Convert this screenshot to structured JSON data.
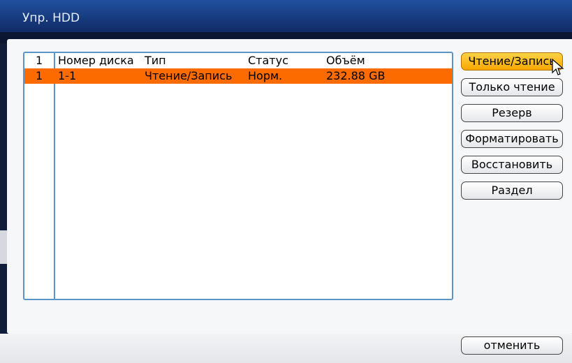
{
  "window": {
    "title": "Упр. HDD"
  },
  "table": {
    "headers": {
      "num": "1",
      "disk": "Номер диска",
      "type": "Тип",
      "status": "Статус",
      "size": "Объём"
    },
    "rows": [
      {
        "num": "1",
        "disk": "1-1",
        "type": "Чтение/Запись",
        "status": "Норм.",
        "size": "232.88 GB"
      }
    ]
  },
  "actions": {
    "read_write": "Чтение/Запись",
    "read_only": "Только чтение",
    "reserve": "Резерв",
    "format": "Форматировать",
    "restore": "Восстановить",
    "partition": "Раздел"
  },
  "footer": {
    "cancel": "отменить"
  },
  "colors": {
    "selected_row": "#fb6b00",
    "active_button": "#f7a800",
    "table_border": "#5a94c8"
  }
}
